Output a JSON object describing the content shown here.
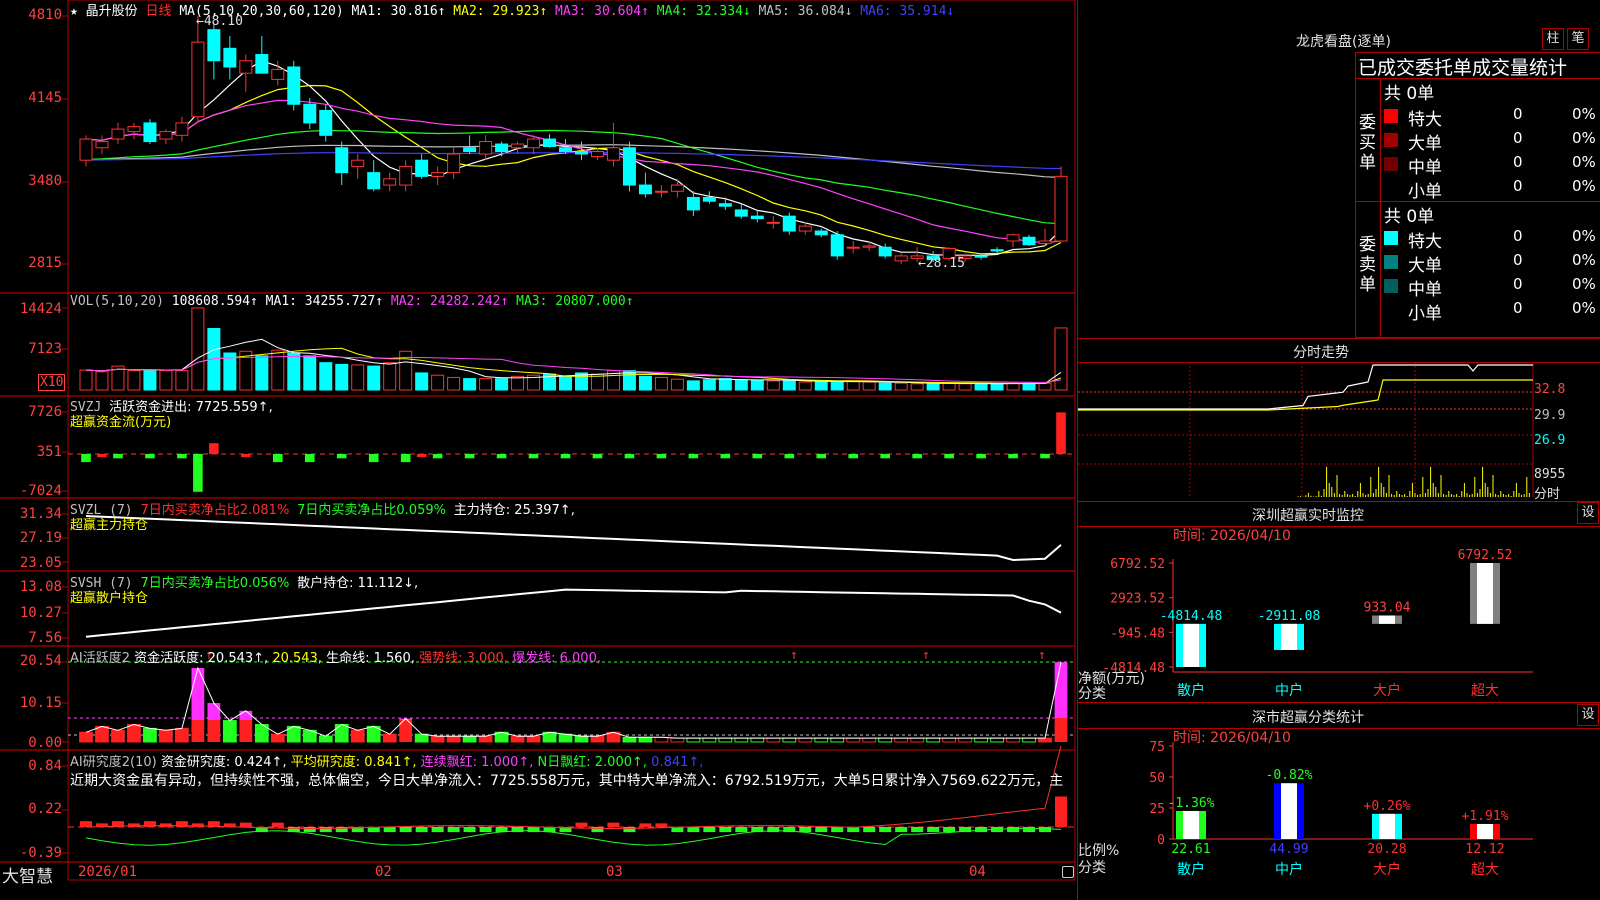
{
  "stock": {
    "name": "晶升股份",
    "period": "日线",
    "star": "★"
  },
  "main": {
    "ma_label": "MA(5,10,20,30,60,120)",
    "ma": [
      {
        "label": "MA1: 30.816↑",
        "color": "#ffffff"
      },
      {
        "label": "MA2: 29.923↑",
        "color": "#ffff00"
      },
      {
        "label": "MA3: 30.604↑",
        "color": "#ff40ff"
      },
      {
        "label": "MA4: 32.334↓",
        "color": "#20ff20"
      },
      {
        "label": "MA5: 36.084↓",
        "color": "#c0c0c0"
      },
      {
        "label": "MA6: 35.914↓",
        "color": "#4040ff"
      }
    ],
    "y_ticks": [
      "4810",
      "4145",
      "3480",
      "2815"
    ],
    "high_mark": "48.10",
    "low_mark": "←28.15",
    "candles": [
      [
        36.5,
        38.5,
        36.0,
        38.2
      ],
      [
        37.5,
        38.5,
        37.0,
        38.0
      ],
      [
        38.2,
        39.5,
        37.8,
        39.0
      ],
      [
        38.8,
        39.5,
        38.2,
        39.2
      ],
      [
        39.5,
        39.8,
        37.8,
        38.0
      ],
      [
        38.2,
        39.0,
        37.8,
        38.8
      ],
      [
        38.5,
        40.0,
        38.0,
        39.5
      ],
      [
        40.0,
        48.1,
        39.5,
        46.0
      ],
      [
        47.0,
        47.5,
        43.0,
        44.5
      ],
      [
        45.5,
        46.5,
        43.0,
        44.0
      ],
      [
        43.5,
        45.0,
        42.0,
        44.5
      ],
      [
        45.0,
        46.5,
        43.5,
        43.5
      ],
      [
        43.0,
        44.5,
        42.5,
        43.8
      ],
      [
        44.0,
        44.5,
        40.5,
        41.0
      ],
      [
        41.0,
        41.5,
        39.0,
        39.5
      ],
      [
        40.5,
        41.0,
        38.0,
        38.5
      ],
      [
        37.5,
        38.0,
        34.5,
        35.5
      ],
      [
        36.0,
        37.0,
        35.0,
        36.5
      ],
      [
        35.5,
        36.5,
        34.0,
        34.2
      ],
      [
        34.5,
        35.5,
        34.0,
        35.0
      ],
      [
        34.5,
        36.5,
        34.0,
        36.0
      ],
      [
        36.5,
        37.0,
        35.0,
        35.2
      ],
      [
        35.2,
        36.0,
        34.5,
        35.5
      ],
      [
        35.5,
        37.5,
        35.0,
        37.0
      ],
      [
        37.5,
        38.5,
        37.0,
        37.2
      ],
      [
        37.0,
        38.5,
        36.5,
        38.0
      ],
      [
        37.8,
        38.0,
        36.8,
        37.2
      ],
      [
        37.5,
        38.0,
        37.0,
        37.8
      ],
      [
        37.5,
        38.5,
        37.0,
        38.2
      ],
      [
        38.2,
        38.6,
        37.5,
        37.6
      ],
      [
        37.5,
        38.2,
        37.0,
        37.2
      ],
      [
        37.2,
        38.0,
        36.5,
        37.0
      ],
      [
        36.8,
        37.5,
        36.5,
        37.2
      ],
      [
        36.5,
        39.5,
        36.0,
        37.5
      ],
      [
        37.5,
        38.0,
        34.0,
        34.5
      ],
      [
        34.5,
        35.5,
        33.5,
        33.8
      ],
      [
        34.0,
        34.5,
        33.5,
        34.0
      ],
      [
        34.0,
        35.0,
        33.5,
        34.5
      ],
      [
        33.5,
        34.0,
        32.0,
        32.5
      ],
      [
        33.5,
        34.0,
        33.0,
        33.2
      ],
      [
        33.0,
        33.5,
        32.5,
        32.8
      ],
      [
        32.5,
        33.0,
        31.8,
        32.0
      ],
      [
        32.0,
        32.5,
        31.5,
        31.8
      ],
      [
        31.5,
        32.0,
        31.0,
        31.5
      ],
      [
        32.0,
        32.3,
        30.5,
        30.8
      ],
      [
        30.8,
        31.5,
        30.5,
        31.2
      ],
      [
        30.8,
        31.0,
        30.3,
        30.5
      ],
      [
        30.5,
        30.8,
        28.5,
        28.8
      ],
      [
        29.5,
        30.0,
        29.0,
        29.5
      ],
      [
        29.5,
        30.0,
        29.2,
        29.6
      ],
      [
        29.5,
        29.8,
        28.6,
        28.8
      ],
      [
        28.4,
        29.0,
        28.15,
        28.8
      ],
      [
        28.6,
        29.5,
        28.3,
        28.8
      ],
      [
        28.8,
        29.2,
        28.3,
        28.5
      ],
      [
        28.6,
        29.5,
        28.4,
        29.4
      ],
      [
        28.6,
        29.0,
        28.3,
        28.8
      ],
      [
        28.8,
        29.0,
        28.5,
        28.7
      ],
      [
        29.3,
        29.5,
        29.0,
        29.2
      ],
      [
        30.0,
        30.6,
        29.5,
        30.5
      ],
      [
        30.3,
        30.5,
        29.6,
        29.7
      ],
      [
        29.8,
        31.0,
        29.6,
        30.0
      ],
      [
        30.0,
        36.0,
        30.0,
        35.2
      ]
    ]
  },
  "vol": {
    "label": "VOL(5,10,20)",
    "value": "108608.594↑",
    "ma1": "MA1: 34255.727↑",
    "ma2": "MA2: 24282.242↑",
    "ma3": "MA3: 20807.000↑",
    "y_ticks": [
      "14424",
      "7123"
    ],
    "x10": "X10",
    "bars": [
      3.5,
      3.2,
      4.2,
      3.4,
      3.4,
      3.4,
      3.4,
      14.4,
      10.8,
      6.5,
      6.8,
      6.0,
      7.0,
      6.5,
      6.0,
      4.8,
      4.5,
      4.4,
      4.2,
      4.8,
      6.8,
      3.0,
      2.6,
      2.2,
      2.0,
      2.0,
      2.0,
      2.4,
      2.6,
      2.8,
      2.5,
      3.0,
      2.8,
      3.4,
      3.4,
      2.4,
      2.2,
      1.9,
      1.6,
      1.8,
      2.0,
      1.8,
      1.7,
      1.6,
      1.6,
      1.4,
      1.4,
      1.5,
      1.5,
      1.4,
      1.2,
      1.2,
      1.1,
      1.1,
      1.2,
      1.1,
      1.1,
      1.0,
      1.2,
      1.2,
      1.2,
      10.9
    ]
  },
  "svzj": {
    "label": "SVZJ",
    "desc": "活跃资金进出: 7725.559↑,",
    "sub": "超赢资金流(万元)",
    "y_ticks": [
      "7726",
      "351",
      "-7024"
    ],
    "bars": [
      -1.5,
      0,
      -0.8,
      -0.8,
      -0.8,
      -0.8,
      -0.8,
      -7.0,
      2.0,
      -0.8,
      0,
      -1.2,
      -1.5,
      -1.5,
      -1.5,
      -0.8,
      -0.8,
      -0.8,
      -1.5,
      -1.5,
      -1.5,
      0,
      -0.8,
      -0.8,
      -0.8,
      -0.8,
      -0.8,
      -0.8,
      -0.8,
      -0.8,
      -0.8,
      -0.8,
      -0.8,
      -0.8,
      -0.8,
      -0.8,
      -0.8,
      -0.8,
      -0.8,
      -0.8,
      -0.8,
      -0.8,
      -0.8,
      -0.8,
      -0.8,
      -0.8,
      -0.8,
      -0.8,
      -0.8,
      -0.8,
      -0.8,
      -0.8,
      -0.8,
      -0.8,
      -0.8,
      -0.8,
      -0.8,
      -0.8,
      -0.8,
      -0.8,
      -0.8,
      7.7
    ]
  },
  "svzl": {
    "label": "SVZL (7)",
    "a": "7日内买卖净占比2.081%",
    "b": "7日内买卖净占比0.059%",
    "c": "主力持仓: 25.397↑,",
    "sub": "超赢主力持仓",
    "y_ticks": [
      "31.34",
      "27.19",
      "23.05"
    ]
  },
  "svsh": {
    "label": "SVSH (7)",
    "a": "7日内买卖净占比0.056%",
    "b": "散户持仓: 11.112↓,",
    "sub": "超赢散户持仓",
    "y_ticks": [
      "13.08",
      "10.27",
      "7.56"
    ]
  },
  "ai1": {
    "label": "AI活跃度2",
    "a": "资金活跃度: 20.543↑,",
    "b": "20.543,",
    "c": "生命线: 1.560,",
    "d": "强势线: 3.000,",
    "e": "爆发线: 6.000,",
    "y_ticks": [
      "20.54",
      "10.15",
      "0.00"
    ]
  },
  "ai2": {
    "label": "AI研究度2(10)",
    "a": "资金研究度: 0.424↑,",
    "b": "平均研究度: 0.841↑,",
    "c": "连续飘红: 1.000↑,",
    "d": "N日飘红: 2.000↑,",
    "e": "0.841↑,",
    "comment": "近期大资金虽有异动，但持续性不强，总体偏空，今日大单净流入：7725.558万元，其中特大单净流入：6792.519万元，大单5日累计净入7569.622万元，主",
    "y_ticks": [
      "0.84",
      "0.22",
      "-0.39"
    ]
  },
  "xaxis": {
    "brand": "大智慧",
    "labels": [
      "2026/01",
      "02",
      "03",
      "04"
    ]
  },
  "right": {
    "title": "龙虎看盘(逐单)",
    "btn1": "柱",
    "btn2": "笔",
    "sub": "已成交委托单成交量统计",
    "buy": {
      "side": "委买单",
      "total": "共 0单",
      "rows": [
        {
          "label": "特大",
          "count": "0",
          "pct": "0%",
          "color": "#ff0000"
        },
        {
          "label": "大单",
          "count": "0",
          "pct": "0%",
          "color": "#a00000"
        },
        {
          "label": "中单",
          "count": "0",
          "pct": "0%",
          "color": "#700000"
        },
        {
          "label": "小单",
          "count": "0",
          "pct": "0%",
          "color": "#000000"
        }
      ]
    },
    "sell": {
      "side": "委卖单",
      "total": "共 0单",
      "rows": [
        {
          "label": "特大",
          "count": "0",
          "pct": "0%",
          "color": "#00ffff"
        },
        {
          "label": "大单",
          "count": "0",
          "pct": "0%",
          "color": "#008080"
        },
        {
          "label": "中单",
          "count": "0",
          "pct": "0%",
          "color": "#006060"
        },
        {
          "label": "小单",
          "count": "0",
          "pct": "0%",
          "color": "#000000"
        }
      ]
    },
    "intraday": {
      "title": "分时走势",
      "ticks": [
        "32.8",
        "29.9",
        "26.9",
        "8955"
      ],
      "unit": "分时"
    },
    "monitor": {
      "title": "深圳超赢实时监控",
      "btn": "设",
      "time": "时间: 2026/04/10",
      "y_ticks": [
        "6792.52",
        "2923.52",
        "-945.48",
        "-4814.48"
      ],
      "axis_label": "净额(万元)",
      "cat_label": "分类",
      "cats": [
        "散户",
        "中户",
        "大户",
        "超大"
      ],
      "values": [
        -4814.48,
        -2911.08,
        933.04,
        6792.52
      ],
      "value_labels": [
        "-4814.48",
        "-2911.08",
        "933.04",
        "6792.52"
      ]
    },
    "stats": {
      "title": "深市超赢分类统计",
      "btn": "设",
      "time": "时间: 2026/04/10",
      "y_ticks": [
        "75",
        "50",
        "25",
        "0"
      ],
      "axis_label": "比例%",
      "cat_label": "分类",
      "cats": [
        "散户",
        "中户",
        "大户",
        "超大"
      ],
      "values": [
        22.61,
        44.99,
        20.28,
        12.12
      ],
      "value_labels": [
        "22.61",
        "44.99",
        "20.28",
        "12.12"
      ],
      "changes": [
        "-1.36%",
        "-0.82%",
        "+0.26%",
        "+1.91%"
      ]
    }
  }
}
